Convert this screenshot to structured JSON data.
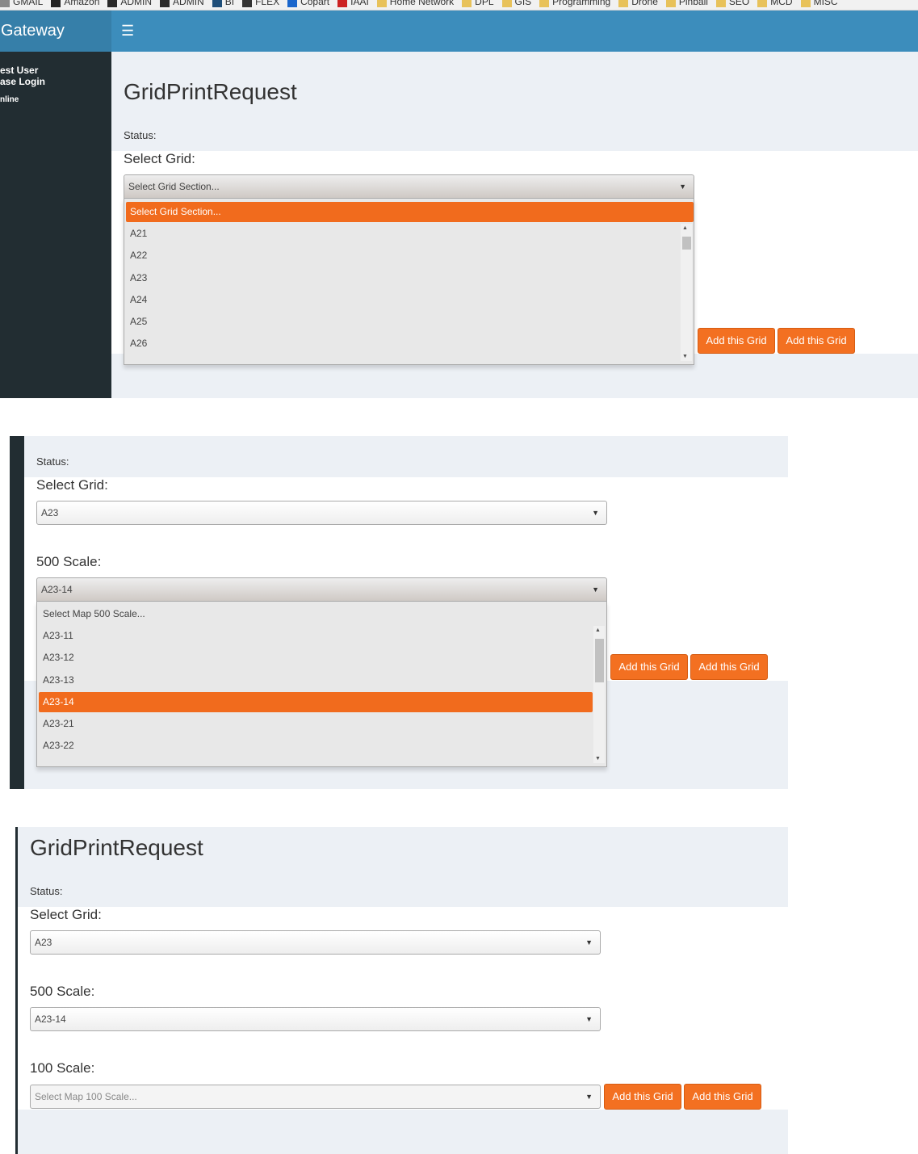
{
  "bookmarks": [
    {
      "label": "GMAIL",
      "icon": "bookmark-icon",
      "color": "#888888"
    },
    {
      "label": "Amazon",
      "icon": "amazon-icon",
      "color": "#222222"
    },
    {
      "label": "ADMIN",
      "icon": "admin-icon",
      "color": "#2a2a2a"
    },
    {
      "label": "ADMIN",
      "icon": "admin-icon",
      "color": "#2a2a2a"
    },
    {
      "label": "BI",
      "icon": "bi-icon",
      "color": "#1f4e79"
    },
    {
      "label": "FLEX",
      "icon": "flex-icon",
      "color": "#333333"
    },
    {
      "label": "Copart",
      "icon": "copart-icon",
      "color": "#1a66cc"
    },
    {
      "label": "IAAI",
      "icon": "iaai-icon",
      "color": "#cc2222"
    },
    {
      "label": "Home Network",
      "icon": "folder-icon",
      "color": "#e8c25a"
    },
    {
      "label": "DPL",
      "icon": "folder-icon",
      "color": "#e8c25a"
    },
    {
      "label": "GIS",
      "icon": "folder-icon",
      "color": "#e8c25a"
    },
    {
      "label": "Programming",
      "icon": "folder-icon",
      "color": "#e8c25a"
    },
    {
      "label": "Drone",
      "icon": "folder-icon",
      "color": "#e8c25a"
    },
    {
      "label": "Pinball",
      "icon": "folder-icon",
      "color": "#e8c25a"
    },
    {
      "label": "SEO",
      "icon": "folder-icon",
      "color": "#e8c25a"
    },
    {
      "label": "MCD",
      "icon": "folder-icon",
      "color": "#e8c25a"
    },
    {
      "label": "MISC",
      "icon": "folder-icon",
      "color": "#e8c25a"
    }
  ],
  "header": {
    "brand": "Gateway",
    "menu_icon": "hamburger-icon",
    "bar_color": "#3c8dbc"
  },
  "sidebar": {
    "user_line1": "est User",
    "user_line2": "ase Login",
    "status": "nline"
  },
  "accent_color": "#f37021",
  "panel1": {
    "title": "GridPrintRequest",
    "status_label": "Status:",
    "grid_label": "Select Grid:",
    "grid_select_value": "Select Grid Section...",
    "grid_options": [
      "Select Grid Section...",
      "A21",
      "A22",
      "A23",
      "A24",
      "A25",
      "A26"
    ],
    "button1": "Add this Grid",
    "button2": "Add this Grid"
  },
  "panel2": {
    "status_label": "Status:",
    "grid_label": "Select Grid:",
    "grid_value": "A23",
    "scale500_label": "500 Scale:",
    "scale500_value": "A23-14",
    "scale500_options": [
      "Select Map 500 Scale...",
      "A23-11",
      "A23-12",
      "A23-13",
      "A23-14",
      "A23-21",
      "A23-22"
    ],
    "button1": "Add this Grid",
    "button2": "Add this Grid"
  },
  "panel3": {
    "title": "GridPrintRequest",
    "status_label": "Status:",
    "grid_label": "Select Grid:",
    "grid_value": "A23",
    "scale500_label": "500 Scale:",
    "scale500_value": "A23-14",
    "scale100_label": "100 Scale:",
    "scale100_placeholder": "Select Map 100 Scale...",
    "button1": "Add this Grid",
    "button2": "Add this Grid"
  }
}
